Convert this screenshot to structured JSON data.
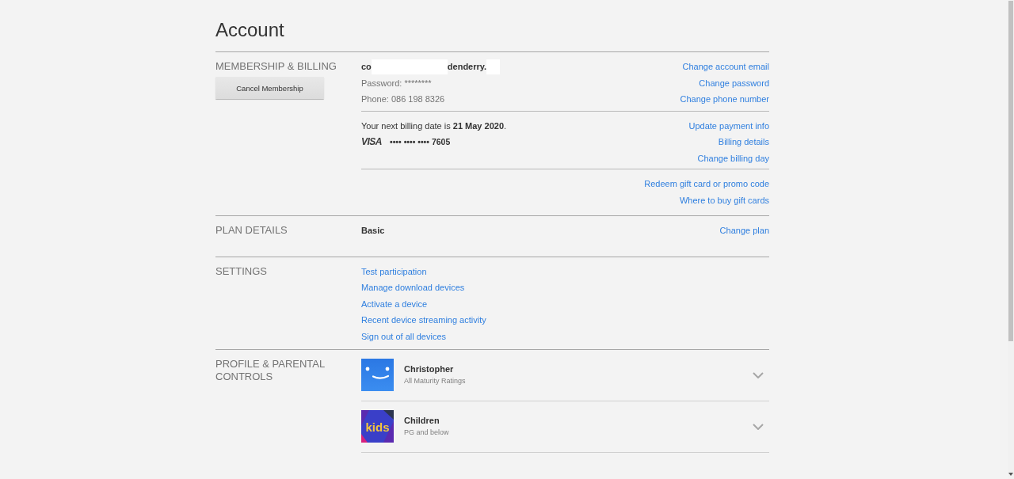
{
  "page": {
    "title": "Account"
  },
  "membership": {
    "label": "MEMBERSHIP & BILLING",
    "cancel_button": "Cancel Membership",
    "email_parts": [
      {
        "kind": "text",
        "text": "co"
      },
      {
        "kind": "redacted"
      },
      {
        "kind": "text",
        "text": "denderry."
      },
      {
        "kind": "redacted"
      }
    ],
    "password": "Password: ********",
    "phone": "Phone: 086 198 8326",
    "account_links": [
      "Change account email",
      "Change password",
      "Change phone number"
    ],
    "billing_date": "Your next billing date is **21 May 2020**.",
    "card_brand": "VISA",
    "card_number": "•••• •••• •••• 7605",
    "billing_links": [
      "Update payment info",
      "Billing details",
      "Change billing day"
    ],
    "gift_links": [
      "Redeem gift card or promo code",
      "Where to buy gift cards"
    ]
  },
  "plan": {
    "label": "PLAN DETAILS",
    "name": "Basic",
    "link": "Change plan"
  },
  "settings": {
    "label": "SETTINGS",
    "links": [
      "Test participation",
      "Manage download devices",
      "Activate a device",
      "Recent device streaming activity",
      "Sign out of all devices"
    ]
  },
  "profiles": {
    "label": "PROFILE & PARENTAL CONTROLS",
    "items": [
      {
        "name": "Christopher",
        "rating": "All Maturity Ratings",
        "avatar": {
          "kind": "smiley"
        },
        "expanded": false
      },
      {
        "name": "Children",
        "rating": "PG and below",
        "avatar": {
          "kind": "kids",
          "text": "kids"
        },
        "expanded": false
      }
    ]
  }
}
